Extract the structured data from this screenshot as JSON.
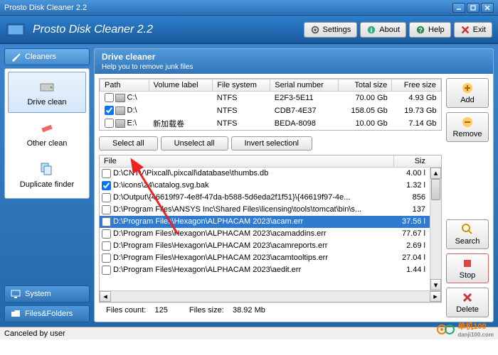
{
  "window": {
    "title": "Prosto Disk Cleaner 2.2"
  },
  "header": {
    "appTitle": "Prosto Disk Cleaner 2.2",
    "settings": "Settings",
    "about": "About",
    "help": "Help",
    "exit": "Exit"
  },
  "sidebar": {
    "tabs": {
      "cleaners": "Cleaners",
      "system": "System",
      "filesFolders": "Files&Folders"
    },
    "items": {
      "driveClean": "Drive clean",
      "otherClean": "Other clean",
      "dupFinder": "Duplicate finder"
    }
  },
  "panel": {
    "title": "Drive cleaner",
    "subtitle": "Help you to remove junk files"
  },
  "driveTable": {
    "headers": {
      "path": "Path",
      "volume": "Volume label",
      "fs": "File system",
      "serial": "Serial number",
      "total": "Total size",
      "free": "Free size"
    },
    "rows": [
      {
        "checked": false,
        "path": "C:\\",
        "volume": "",
        "fs": "NTFS",
        "serial": "E2F3-5E11",
        "total": "70.00 Gb",
        "free": "4.93 Gb"
      },
      {
        "checked": true,
        "path": "D:\\",
        "volume": "",
        "fs": "NTFS",
        "serial": "CDB7-4E37",
        "total": "158.05 Gb",
        "free": "19.73 Gb"
      },
      {
        "checked": false,
        "path": "E:\\",
        "volume": "新加载卷",
        "fs": "NTFS",
        "serial": "BEDA-8098",
        "total": "10.00 Gb",
        "free": "7.14 Gb"
      }
    ]
  },
  "buttons": {
    "selectAll": "Select all",
    "unselectAll": "Unselect all",
    "invert": "Invert selectionl",
    "add": "Add",
    "remove": "Remove",
    "search": "Search",
    "stop": "Stop",
    "delete": "Delete"
  },
  "fileTable": {
    "headers": {
      "file": "File",
      "size": "Siz"
    },
    "rows": [
      {
        "checked": false,
        "path": "D:\\CNTV\\Pixcall\\.pixcall\\database\\thumbs.db",
        "size": "4.00 l",
        "selected": false
      },
      {
        "checked": true,
        "path": "D:\\icons\\24\\catalog.svg.bak",
        "size": "1.32 l",
        "selected": false
      },
      {
        "checked": false,
        "path": "D:\\Output\\{46619f97-4e8f-47da-b588-5d6eda2f1f51}\\{46619f97-4e...",
        "size": "856",
        "selected": false
      },
      {
        "checked": false,
        "path": "D:\\Program Files\\ANSYS Inc\\Shared Files\\licensing\\tools\\tomcat\\bin\\s...",
        "size": "137",
        "selected": false
      },
      {
        "checked": false,
        "path": "D:\\Program Files\\Hexagon\\ALPHACAM 2023\\acam.err",
        "size": "37.56 l",
        "selected": true
      },
      {
        "checked": false,
        "path": "D:\\Program Files\\Hexagon\\ALPHACAM 2023\\acamaddins.err",
        "size": "77.67 l",
        "selected": false
      },
      {
        "checked": false,
        "path": "D:\\Program Files\\Hexagon\\ALPHACAM 2023\\acamreports.err",
        "size": "2.69 l",
        "selected": false
      },
      {
        "checked": false,
        "path": "D:\\Program Files\\Hexagon\\ALPHACAM 2023\\acamtooltips.err",
        "size": "27.04 l",
        "selected": false
      },
      {
        "checked": false,
        "path": "D:\\Program Files\\Hexagon\\ALPHACAM 2023\\aedit.err",
        "size": "1.44 l",
        "selected": false
      }
    ]
  },
  "status": {
    "filesCountLabel": "Files count:",
    "filesCount": "125",
    "filesSizeLabel": "Files size:",
    "filesSize": "38.92 Mb"
  },
  "statusbar": {
    "message": "Canceled by user"
  },
  "watermark": {
    "text": "单机100",
    "sub": "danji100.com"
  }
}
